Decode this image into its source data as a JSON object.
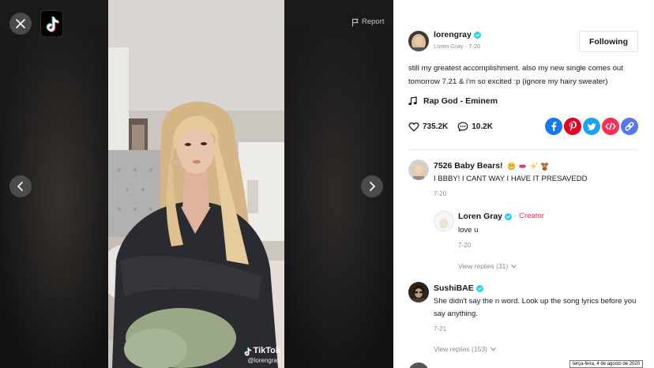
{
  "viewer": {
    "logo_icon": "tiktok-logo",
    "report_label": "Report",
    "watermark_brand": "TikTok",
    "watermark_handle": "@lorengray"
  },
  "author": {
    "username": "lorengray",
    "display_name": "Loren Gray",
    "meta_separator": "·",
    "date": "7-20",
    "verified": true
  },
  "follow_button": {
    "label": "Following"
  },
  "caption": "still my greatest accomplishment. also my new single comes out tomorrow 7.21 & i'm so excited :p (ignore my hairy sweater)",
  "music": {
    "icon": "music-note-icon",
    "title": "Rap God - Eminem"
  },
  "stats": {
    "likes": "735.2K",
    "comments": "10.2K"
  },
  "share_icons": [
    "facebook-icon",
    "pinterest-icon",
    "twitter-icon",
    "embed-icon",
    "link-icon"
  ],
  "colors": {
    "accent": "#FE2C55",
    "verified": "#20D5EC",
    "text": "#161823",
    "muted": "#8A8B91"
  },
  "comments": [
    {
      "name": "7526 Baby Bears!",
      "name_emoji": [
        "grimacing-face",
        "kiss-mark",
        "sparkles",
        "teddy-bear"
      ],
      "text": "I BBBY! I CANT WAY I HAVE IT PRESAVEDD",
      "date": "7-20",
      "replies": [
        {
          "name": "Loren Gray",
          "verified": true,
          "separator": "·",
          "badge": "Creator",
          "text": "love u",
          "date": "7-20"
        }
      ],
      "view_replies_label": "View replies (31)"
    },
    {
      "name": "SushiBAE",
      "verified": true,
      "text": "She didn't say the n word. Look up the song lyrics before you say anything.",
      "date": "7-21",
      "view_replies_label": "View replies (153)"
    }
  ],
  "system_tooltip": "terça-feira, 4 de agosto de 2020"
}
